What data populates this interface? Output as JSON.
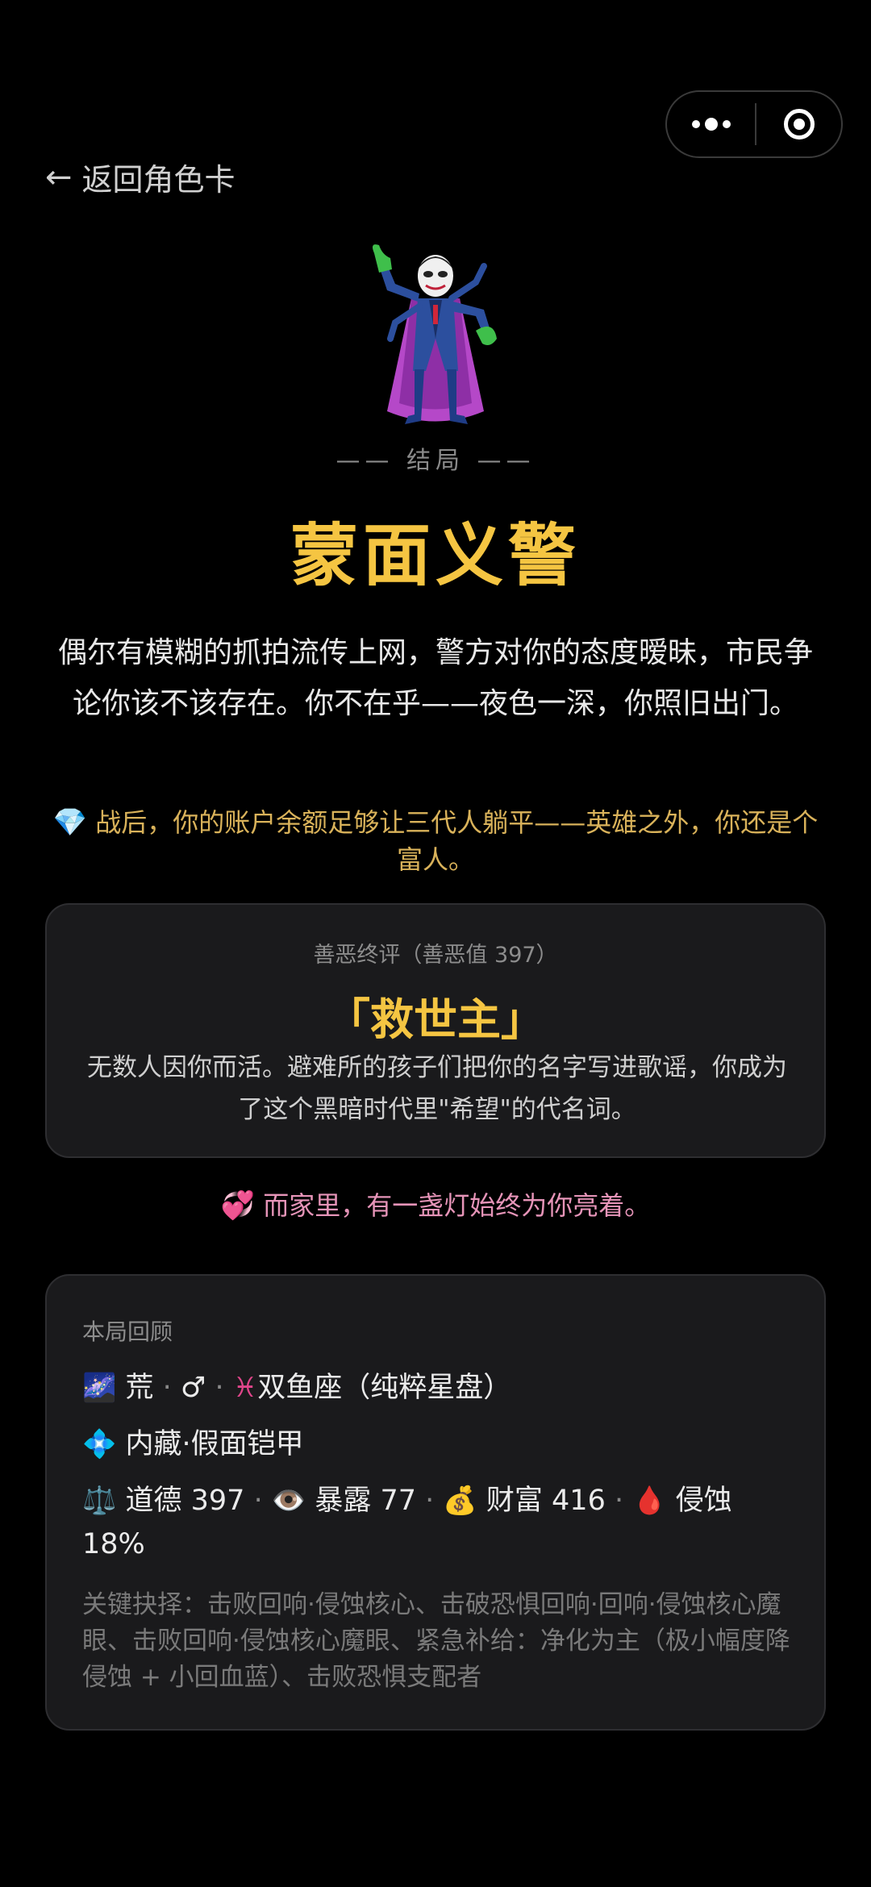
{
  "nav": {
    "back_label": "返回角色卡"
  },
  "ending": {
    "section_label": "—— 结局 ——",
    "title": "蒙面义警",
    "description": "偶尔有模糊的抓拍流传上网，警方对你的态度暧昧，市民争论你该不该存在。你不在乎——夜色一深，你照旧出门。",
    "wealth_icon": "💎",
    "wealth_text": "战后，你的账户余额足够让三代人躺平——英雄之外，你还是个富人。"
  },
  "verdict": {
    "header": "善恶终评（善恶值 397）",
    "title": "「救世主」",
    "text": "无数人因你而活。避难所的孩子们把你的名字写进歌谣，你成为了这个黑暗时代里\"希望\"的代名词。"
  },
  "home": {
    "icon": "💞",
    "text": "而家里，有一盏灯始终为你亮着。"
  },
  "recap": {
    "header": "本局回顾",
    "line1": {
      "icon": "🌌",
      "world": "荒",
      "sep": "·",
      "gender": "♂",
      "zodiac_icon": "♓",
      "zodiac": "双鱼座（纯粹星盘）"
    },
    "line2": {
      "icon": "💠",
      "text": "内藏·假面铠甲"
    },
    "line3": {
      "morality_icon": "⚖️",
      "morality": "道德 397",
      "exposure_icon": "👁️",
      "exposure": "暴露 77",
      "wealth_icon": "💰",
      "wealth": "财富 416",
      "erosion_icon": "🩸",
      "erosion": "侵蚀 18%"
    },
    "key_choices": "关键抉择：击败回响·侵蚀核心、击破恐惧回响·回响·侵蚀核心魔眼、击败回响·侵蚀核心魔眼、紧急补给：净化为主（极小幅度降侵蚀 + 小回血蓝）、击败恐惧支配者"
  },
  "colors": {
    "accent_gold": "#f5c542",
    "wealth_gold": "#d9b25a",
    "pink": "#e694b8"
  }
}
